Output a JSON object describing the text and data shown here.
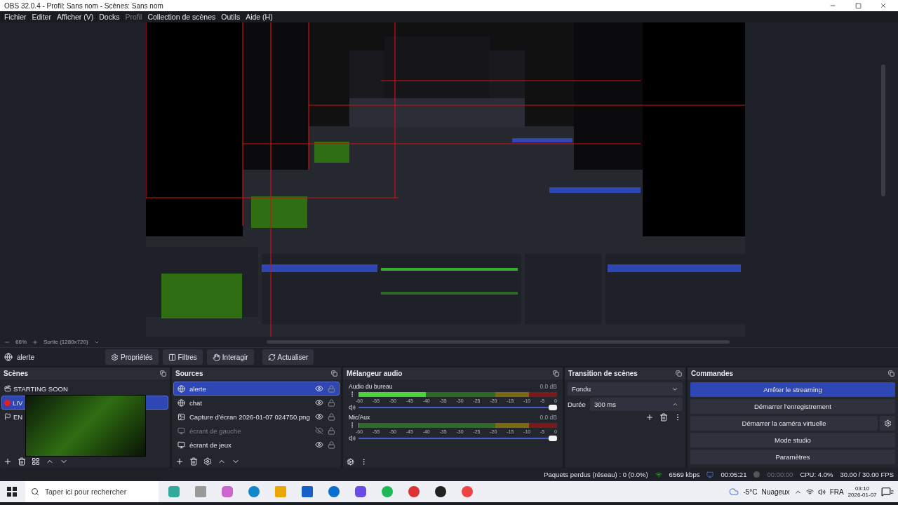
{
  "window": {
    "title": "OBS 32.0.4 - Profil: Sans nom - Scènes: Sans nom"
  },
  "menu": [
    {
      "label": "Fichier",
      "disabled": false
    },
    {
      "label": "Editer",
      "disabled": false
    },
    {
      "label": "Afficher (V)",
      "disabled": false
    },
    {
      "label": "Docks",
      "disabled": false
    },
    {
      "label": "Profil",
      "disabled": true
    },
    {
      "label": "Collection de scènes",
      "disabled": false
    },
    {
      "label": "Outils",
      "disabled": false
    },
    {
      "label": "Aide (H)",
      "disabled": false
    }
  ],
  "preview": {
    "zoom": "66%",
    "output": "Sortie (1280x720)"
  },
  "context_bar": {
    "source": "alerte",
    "buttons": [
      {
        "kind": "properties",
        "label": "Propriétés"
      },
      {
        "kind": "filters",
        "label": "Filtres"
      },
      {
        "kind": "interact",
        "label": "Interagir"
      },
      {
        "kind": "refresh",
        "label": "Actualiser"
      }
    ]
  },
  "scenes": {
    "title": "Scènes",
    "items": [
      {
        "name": "STARTING SOON",
        "kind": "clapper",
        "selected": false
      },
      {
        "name": "LIV",
        "kind": "live",
        "selected": true
      },
      {
        "name": "EN",
        "kind": "flag",
        "selected": false
      }
    ]
  },
  "sources": {
    "title": "Sources",
    "items": [
      {
        "name": "alerte",
        "kind": "browser",
        "visible": true,
        "selected": true
      },
      {
        "name": "chat",
        "kind": "browser",
        "visible": true,
        "selected": false
      },
      {
        "name": "Capture d’écran 2026-01-07 024750.png",
        "kind": "image",
        "visible": true,
        "selected": false
      },
      {
        "name": "écrant de gauche",
        "kind": "display",
        "visible": false,
        "selected": false
      },
      {
        "name": "écrant de jeux",
        "kind": "display",
        "visible": true,
        "selected": false
      }
    ]
  },
  "mixer": {
    "title": "Mélangeur audio",
    "channels": [
      {
        "name": "Audio du bureau",
        "reading": "0.0 dB",
        "meter": {
          "level": 0.34
        },
        "scale": [
          "-60",
          "-55",
          "-50",
          "-45",
          "-40",
          "-35",
          "-30",
          "-25",
          "-20",
          "-15",
          "-10",
          "-5",
          "0"
        ],
        "fader": {
          "level": 1
        }
      },
      {
        "name": "Mic/Aux",
        "reading": "0.0 dB",
        "meter": {
          "level": 0
        },
        "scale": [
          "-60",
          "-55",
          "-50",
          "-45",
          "-40",
          "-35",
          "-30",
          "-25",
          "-20",
          "-15",
          "-10",
          "-5",
          "0"
        ],
        "fader": {
          "level": 1
        }
      }
    ]
  },
  "transition": {
    "title": "Transition de scènes",
    "type": "Fondu",
    "duration_label": "Durée",
    "duration": "300 ms"
  },
  "controls": {
    "title": "Commandes",
    "buttons": [
      {
        "label": "Arrêter le streaming",
        "active": true,
        "has_settings": false
      },
      {
        "label": "Démarrer l'enregistrement",
        "active": false,
        "has_settings": false
      },
      {
        "label": "Démarrer la caméra virtuelle",
        "active": false,
        "has_settings": true
      },
      {
        "label": "Mode studio",
        "active": false,
        "has_settings": false
      },
      {
        "label": "Paramètres",
        "active": false,
        "has_settings": false
      }
    ]
  },
  "status_bar": {
    "dropped": "Paquets perdus (réseau) : 0 (0.0%)",
    "bitrate": "6569 kbps",
    "stream_time": "00:05:21",
    "record_time": "00:00:00",
    "recording": false,
    "cpu": "CPU: 4.0%",
    "fps": "30.00 / 30.00 FPS"
  },
  "taskbar": {
    "search_placeholder": "Taper ici pour rechercher",
    "temperature": "-5°C",
    "weather": "Nuageux",
    "language": "FRA",
    "time": "03:10",
    "date": "2026-01-07",
    "notifications": "2"
  }
}
